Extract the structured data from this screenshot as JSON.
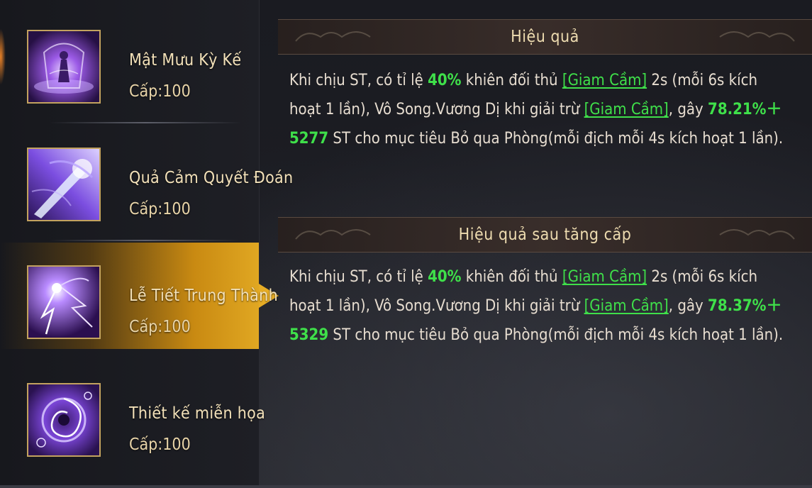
{
  "skills": [
    {
      "name": "Mật Mưu Kỳ Kế",
      "level": "Cấp:100",
      "icon": "purple-ritual-icon"
    },
    {
      "name": "Quả Cảm Quyết Đoán",
      "level": "Cấp:100",
      "icon": "energy-beam-icon"
    },
    {
      "name": "Lễ Tiết Trung Thành",
      "level": "Cấp:100",
      "icon": "lightning-burst-icon"
    },
    {
      "name": "Thiết kế  miễn họa",
      "level": "Cấp:100",
      "icon": "vortex-icon"
    }
  ],
  "selected_skill": "Lễ Tiết Trung Thành",
  "effect": {
    "title": "Hiệu quả",
    "p1": "Khi chịu ST, có tỉ lệ ",
    "v1": "40%",
    "p2": " khiên đối thủ ",
    "t1": "[Giam Cầm]",
    "p3": " 2s (mỗi 6s kích hoạt 1 lần), Vô Song.Vương Dị khi giải trừ ",
    "t2": "[Giam Cầm]",
    "p4": ", gây ",
    "v2": "78.21%＋5277",
    "p5": " ST cho mục tiêu Bỏ qua Phòng(mỗi địch mỗi 4s kích hoạt 1 lần)."
  },
  "upgrade_effect": {
    "title": "Hiệu quả sau tăng cấp",
    "p1": "Khi chịu ST, có tỉ lệ ",
    "v1": "40%",
    "p2": " khiên đối thủ ",
    "t1": "[Giam Cầm]",
    "p3": " 2s (mỗi 6s kích hoạt 1 lần), Vô Song.Vương Dị khi giải trừ ",
    "t2": "[Giam Cầm]",
    "p4": ", gây ",
    "v2": "78.37%＋5329",
    "p5": " ST cho mục tiêu Bỏ qua Phòng(mỗi địch mỗi 4s kích hoạt 1 lần)."
  },
  "colors": {
    "highlight": "#3fe04a",
    "selected_bg": "#e0a722",
    "title_text": "#eedcb0"
  }
}
